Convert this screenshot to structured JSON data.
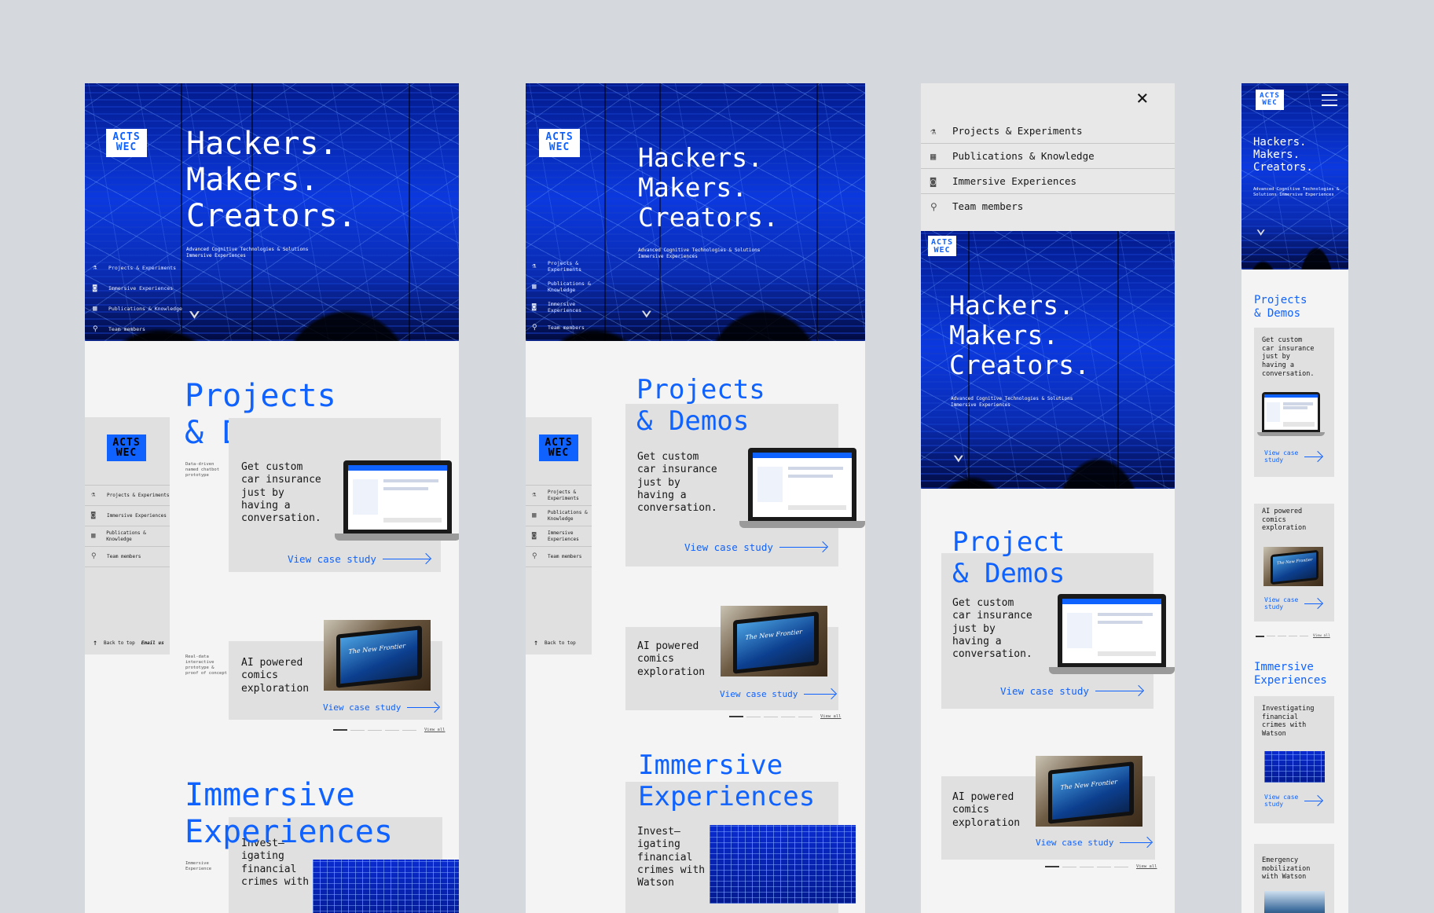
{
  "logo": {
    "line1": "ACTS",
    "line2": "WEC"
  },
  "hero": {
    "title": "Hackers.\nMakers.\nCreators.",
    "subtitle": "Advanced Cognitive Technologies & Solutions\nImmersive Experiences",
    "chevron": "⌄"
  },
  "nav": {
    "projects": "Projects & Experiments",
    "publications": "Publications & Knowledge",
    "immersive": "Immersive Experiences",
    "team": "Team members"
  },
  "nav_wrapped": {
    "projects": "Projects &\nExperiments",
    "publications": "Publications &\nKnowledge",
    "immersive": "Immersive\nExperiences",
    "team": "Team members"
  },
  "icons": {
    "projects": "flask-icon",
    "publications": "grid-icon",
    "immersive": "vr-headset-icon",
    "team": "network-icon",
    "menu": "hamburger-icon",
    "close": "close-icon",
    "back": "arrow-up-icon"
  },
  "footer": {
    "back_to_top": "Back to top",
    "email": "Email us",
    "up_arrow": "↑"
  },
  "sections": {
    "projects": "Projects\n& Demos",
    "projects_alt": "Project\n& Demos",
    "immersive": "Immersive\nExperiences"
  },
  "cards": {
    "insurance": "Get custom\ncar insurance\njust by\nhaving a\nconversation.",
    "comics": "AI powered\ncomics\nexploration",
    "financial_1": "Invest–\nigating\nfinancial\ncrimes with",
    "financial_2": "Invest–\nigating\nfinancial\ncrimes with\nWatson",
    "financial_mobile": "Investigating\nfinancial\ncrimes with\nWatson",
    "emergency": "Emergency\nmobilization\nwith Watson",
    "view": "View case study",
    "view_short": "View case\nstudy"
  },
  "meta": {
    "chatbot": "Data-driven\nnamed chatbot\nprototype",
    "realtime": "Real-data\ninteractive\nprototype &\nproof of concept",
    "immersive": "Immersive\nExperience"
  },
  "pager": {
    "view_all": "View all"
  },
  "tablet": {
    "screen_text": "The New Frontier"
  },
  "colors": {
    "accent": "#0f62fe",
    "background": "#d5d9de",
    "card": "#e0e0e0",
    "page": "#f4f4f4"
  }
}
